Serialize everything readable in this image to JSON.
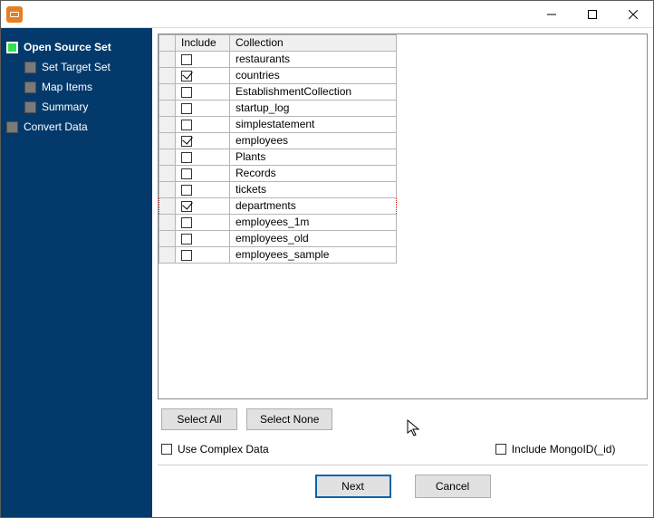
{
  "window": {
    "title": ""
  },
  "sidebar": {
    "steps": [
      {
        "label": "Open Source Set",
        "active": true
      },
      {
        "label": "Set Target Set",
        "active": false,
        "sub": true
      },
      {
        "label": "Map Items",
        "active": false,
        "sub": true
      },
      {
        "label": "Summary",
        "active": false,
        "sub": true
      },
      {
        "label": "Convert Data",
        "active": false
      }
    ]
  },
  "table": {
    "headers": {
      "include": "Include",
      "collection": "Collection"
    },
    "rows": [
      {
        "include": false,
        "name": "restaurants",
        "selected": false
      },
      {
        "include": true,
        "name": "countries",
        "selected": false
      },
      {
        "include": false,
        "name": "EstablishmentCollection",
        "selected": false
      },
      {
        "include": false,
        "name": "startup_log",
        "selected": false
      },
      {
        "include": false,
        "name": "simplestatement",
        "selected": false
      },
      {
        "include": true,
        "name": "employees",
        "selected": false
      },
      {
        "include": false,
        "name": "Plants",
        "selected": false
      },
      {
        "include": false,
        "name": "Records",
        "selected": false
      },
      {
        "include": false,
        "name": "tickets",
        "selected": false
      },
      {
        "include": true,
        "name": "departments",
        "selected": true
      },
      {
        "include": false,
        "name": "employees_1m",
        "selected": false
      },
      {
        "include": false,
        "name": "employees_old",
        "selected": false
      },
      {
        "include": false,
        "name": "employees_sample",
        "selected": false
      }
    ]
  },
  "buttons": {
    "select_all": "Select All",
    "select_none": "Select None",
    "next": "Next",
    "cancel": "Cancel"
  },
  "options": {
    "use_complex_data": {
      "label": "Use Complex Data",
      "checked": false
    },
    "include_mongo_id": {
      "label": "Include MongoID(_id)",
      "checked": false
    }
  }
}
